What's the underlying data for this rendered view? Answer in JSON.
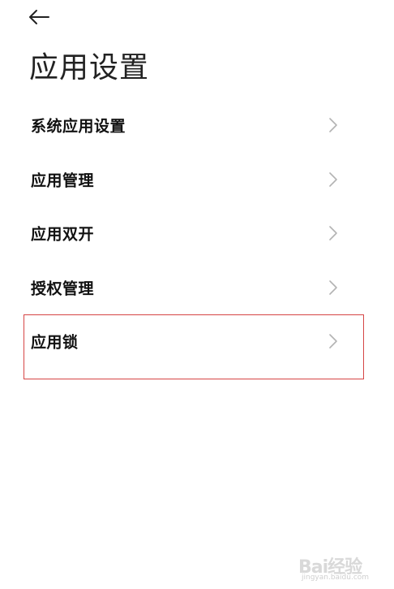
{
  "page": {
    "title": "应用设置"
  },
  "nav": {
    "back_icon": "arrow-left-icon"
  },
  "settings_list": {
    "items": [
      {
        "label": "系统应用设置",
        "icon": "chevron-right-icon"
      },
      {
        "label": "应用管理",
        "icon": "chevron-right-icon"
      },
      {
        "label": "应用双开",
        "icon": "chevron-right-icon"
      },
      {
        "label": "授权管理",
        "icon": "chevron-right-icon"
      },
      {
        "label": "应用锁",
        "icon": "chevron-right-icon",
        "highlighted": true
      }
    ]
  },
  "annotation": {
    "highlight_color": "#d64545"
  },
  "watermark": {
    "brand": "Bai经验",
    "url": "jingyan.baidu.com"
  }
}
